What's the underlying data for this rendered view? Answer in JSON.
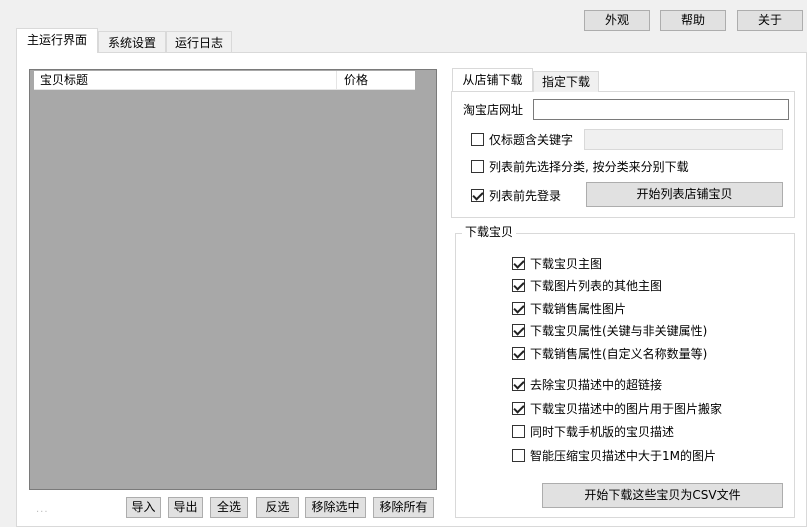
{
  "toolbar": {
    "appearance_label": "外观",
    "help_label": "帮助",
    "about_label": "关于"
  },
  "tabs": [
    {
      "label": "主运行界面",
      "active": true
    },
    {
      "label": "系统设置",
      "active": false
    },
    {
      "label": "运行日志",
      "active": false
    }
  ],
  "item_list": {
    "columns": [
      "宝贝标题",
      "价格"
    ]
  },
  "list_actions": {
    "dots": "...",
    "import_label": "导入",
    "export_label": "导出",
    "select_all_label": "全选",
    "invert_label": "反选",
    "remove_selected_label": "移除选中",
    "remove_all_label": "移除所有"
  },
  "source_tabs": [
    {
      "label": "从店铺下载",
      "active": true
    },
    {
      "label": "指定下载",
      "active": false
    }
  ],
  "store_download": {
    "url_label": "淘宝店网址",
    "url_value": "",
    "keyword_only_label": "仅标题含关键字",
    "keyword_only_checked": false,
    "keyword_value": "",
    "choose_category_label": "列表前先选择分类, 按分类来分别下载",
    "choose_category_checked": false,
    "login_first_label": "列表前先登录",
    "login_first_checked": true,
    "start_list_label": "开始列表店铺宝贝"
  },
  "download_group": {
    "title": "下载宝贝",
    "options": [
      {
        "label": "下载宝贝主图",
        "checked": true
      },
      {
        "label": "下载图片列表的其他主图",
        "checked": true
      },
      {
        "label": "下载销售属性图片",
        "checked": true
      },
      {
        "label": "下载宝贝属性(关键与非关键属性)",
        "checked": true
      },
      {
        "label": "下载销售属性(自定义名称数量等)",
        "checked": true
      },
      {
        "label": "去除宝贝描述中的超链接",
        "checked": true
      },
      {
        "label": "下载宝贝描述中的图片用于图片搬家",
        "checked": true
      },
      {
        "label": "同时下载手机版的宝贝描述",
        "checked": false
      },
      {
        "label": "智能压缩宝贝描述中大于1M的图片",
        "checked": false
      }
    ],
    "start_download_label": "开始下载这些宝贝为CSV文件"
  }
}
